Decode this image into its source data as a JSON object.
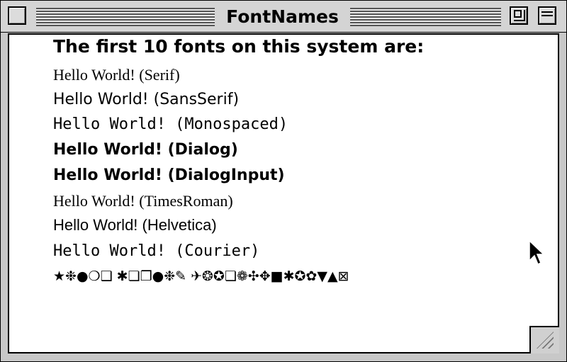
{
  "window": {
    "title": "FontNames"
  },
  "content": {
    "heading": "The first 10 fonts on this system are:",
    "lines": [
      "Hello World! (Serif)",
      "Hello World! (SansSerif)",
      "Hello World! (Monospaced)",
      "Hello World! (Dialog)",
      "Hello World! (DialogInput)",
      "Hello World! (TimesRoman)",
      "Hello World! (Helvetica)",
      "Hello World! (Courier)"
    ],
    "dingbats_line": "★❉●❍❑ ✱❏❐●❉✎ ✈❂✪❏❁✣✥■✱✪✿▼▲⊠"
  },
  "icons": {
    "close": "close-box-icon",
    "zoom": "zoom-box-icon",
    "windowshade": "windowshade-box-icon",
    "grow": "resize-grip-icon",
    "cursor": "arrow-cursor-icon"
  },
  "colors": {
    "window_frame": "#c8c8c8",
    "title_bar": "#d4d4d4",
    "content_background": "#ffffff",
    "text": "#000000"
  }
}
